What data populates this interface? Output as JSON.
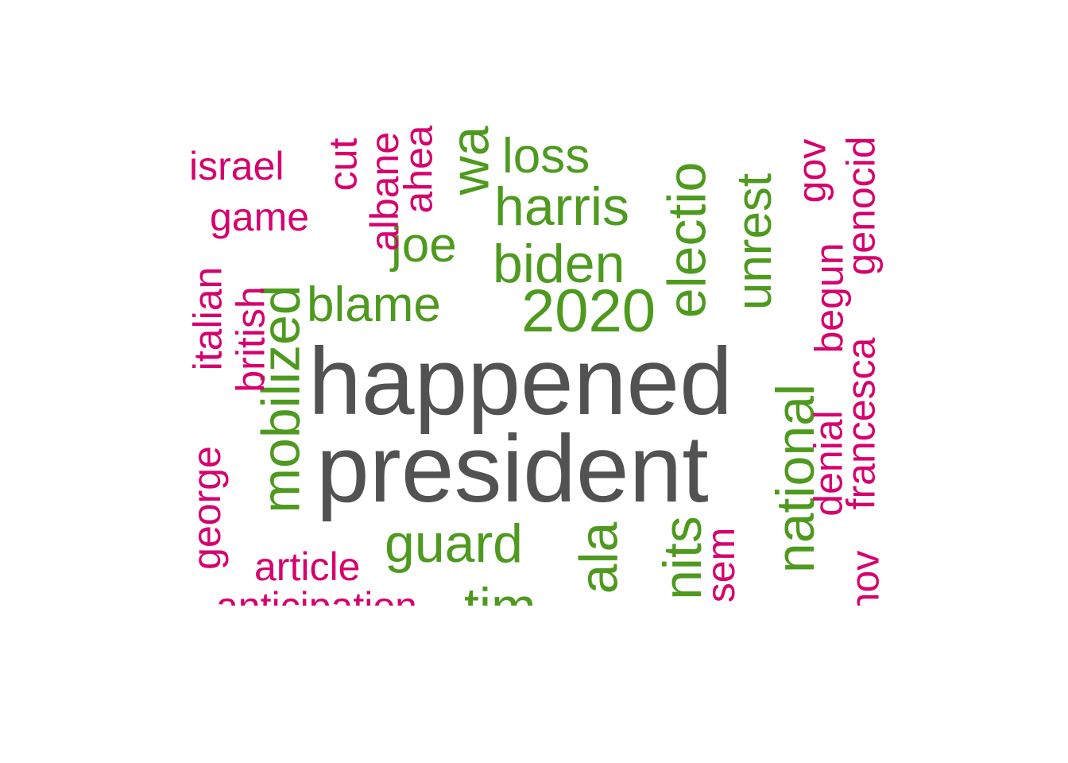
{
  "colors": {
    "top": "#525252",
    "mid": "#4e9a1f",
    "low": "#d6006e"
  },
  "words": {
    "happened": "happened",
    "president": "president",
    "blame": "blame",
    "joe": "joe",
    "loss": "loss",
    "harris": "harris",
    "biden": "biden",
    "y2020": "2020",
    "mobilized": "mobilized",
    "election": "electio",
    "unrest": "unrest",
    "national": "national",
    "guard": "guard",
    "tim": "tim",
    "kamala": "ala",
    "results": "nits",
    "wa": "wa",
    "israel": "israel",
    "game": "game",
    "cut": "cut",
    "albanese": "albane",
    "ahead": "ahea",
    "italian": "italian",
    "british": "british",
    "george": "george",
    "article": "article",
    "anticipation": "anticipation",
    "gov": "gov",
    "genocide": "genocid",
    "begun": "begun",
    "francesca": "francesca",
    "denial": "denial",
    "nov": "nov",
    "sem": "sem"
  }
}
